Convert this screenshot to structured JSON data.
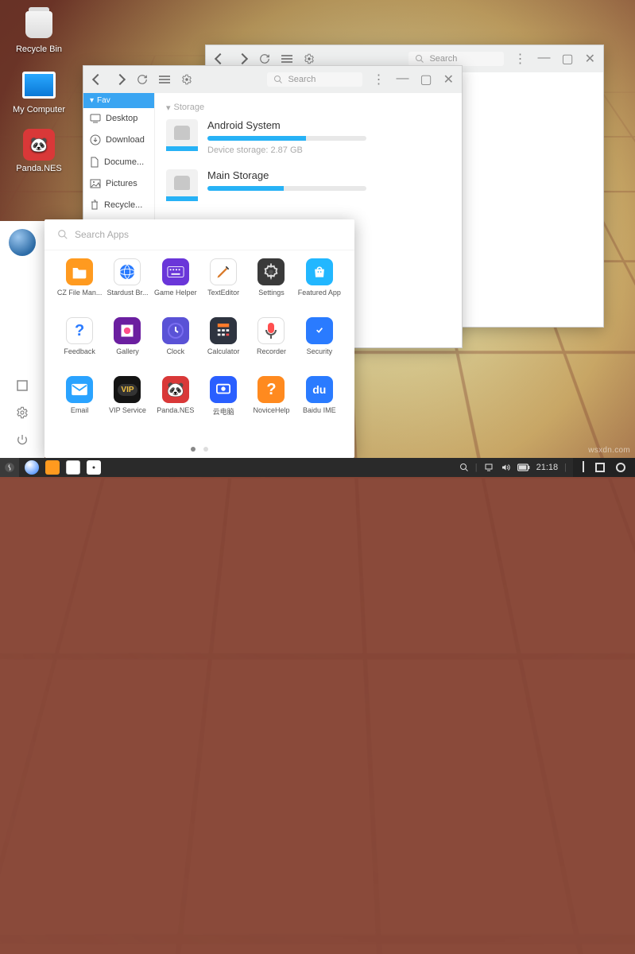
{
  "desktop": {
    "icons": [
      {
        "name": "recycle-bin",
        "label": "Recycle Bin"
      },
      {
        "name": "my-computer",
        "label": "My Computer"
      },
      {
        "name": "panda-nes",
        "label": "Panda.NES"
      }
    ]
  },
  "fm_back": {
    "search_placeholder": "Search"
  },
  "fm_front": {
    "search_placeholder": "Search",
    "sidebar": {
      "header": "Fav",
      "items": [
        {
          "label": "Desktop"
        },
        {
          "label": "Download"
        },
        {
          "label": "Docume..."
        },
        {
          "label": "Pictures"
        },
        {
          "label": "Recycle..."
        }
      ]
    },
    "section": "Storage",
    "storages": [
      {
        "name": "Android System",
        "sub": "Device storage: 2.87 GB",
        "progress": 62
      },
      {
        "name": "Main Storage",
        "sub": "",
        "progress": 48
      }
    ]
  },
  "launcher": {
    "search_placeholder": "Search Apps",
    "apps": [
      {
        "label": "CZ File Man...",
        "icon": "folder",
        "bg": "#ff9a1f"
      },
      {
        "label": "Stardust Br...",
        "icon": "globe",
        "bg": "#ffffff"
      },
      {
        "label": "Game Helper",
        "icon": "keyboard",
        "bg": "#6a36d9"
      },
      {
        "label": "TextEditor",
        "icon": "pencil",
        "bg": "#ffffff"
      },
      {
        "label": "Settings",
        "icon": "gear",
        "bg": "#3a3a3a"
      },
      {
        "label": "Featured App",
        "icon": "bag",
        "bg": "#22b7ff"
      },
      {
        "label": "Feedback",
        "icon": "question",
        "bg": "#ffffff"
      },
      {
        "label": "Gallery",
        "icon": "photo",
        "bg": "#6b1fa0"
      },
      {
        "label": "Clock",
        "icon": "clock",
        "bg": "#5a52d6"
      },
      {
        "label": "Calculator",
        "icon": "calc",
        "bg": "#2e3440"
      },
      {
        "label": "Recorder",
        "icon": "mic",
        "bg": "#ffffff"
      },
      {
        "label": "Security",
        "icon": "shield",
        "bg": "#2a7bff"
      },
      {
        "label": "Email",
        "icon": "mail",
        "bg": "#2aa3ff"
      },
      {
        "label": "VIP Service",
        "icon": "vip",
        "bg": "#141414"
      },
      {
        "label": "Panda.NES",
        "icon": "panda",
        "bg": "#d93838"
      },
      {
        "label": "云电脑",
        "icon": "cloudpc",
        "bg": "#2a5fff"
      },
      {
        "label": "NoviceHelp",
        "icon": "help",
        "bg": "#ff8a1f"
      },
      {
        "label": "Baidu IME",
        "icon": "baidu",
        "bg": "#2a7bff"
      }
    ]
  },
  "taskbar": {
    "time": "21:18"
  },
  "watermark": "wsxdn.com"
}
